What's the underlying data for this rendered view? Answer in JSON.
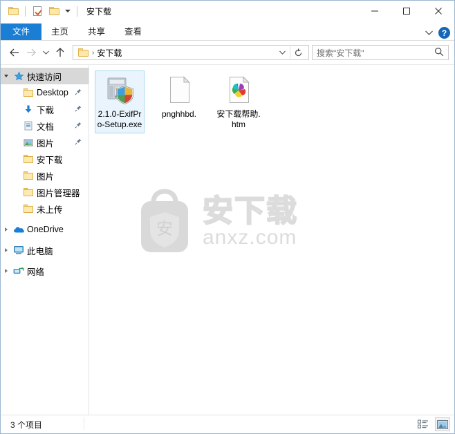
{
  "window": {
    "title": "安下载",
    "quick_access_toolbar": [
      {
        "name": "folder-icon",
        "label": "属性"
      },
      {
        "name": "properties-icon",
        "label": "属性"
      },
      {
        "name": "new-folder-icon",
        "label": "新建文件夹"
      },
      {
        "name": "chevron-down-icon",
        "label": "自定义快速访问工具栏"
      }
    ],
    "controls": {
      "minimize": "最小化",
      "maximize": "最大化",
      "close": "关闭"
    }
  },
  "ribbon": {
    "tabs": [
      {
        "label": "文件",
        "active": true
      },
      {
        "label": "主页",
        "active": false
      },
      {
        "label": "共享",
        "active": false
      },
      {
        "label": "查看",
        "active": false
      }
    ],
    "collapse_label": "展开功能区",
    "help_label": "?"
  },
  "address": {
    "back_label": "后退",
    "forward_label": "前进",
    "recent_label": "最近浏览的位置",
    "up_label": "上移到",
    "path_separator": "›",
    "path_text": "安下载",
    "dropdown_label": "以前的位置",
    "refresh_label": "刷新",
    "search_placeholder": "搜索\"安下载\""
  },
  "sidebar": {
    "items": [
      {
        "label": "快速访问",
        "icon": "star-pin-icon",
        "expander": "down",
        "indent": 0,
        "pinned": false,
        "hover": true
      },
      {
        "label": "Desktop",
        "icon": "folder-icon",
        "expander": "none",
        "indent": 1,
        "pinned": true,
        "hover": false
      },
      {
        "label": "下载",
        "icon": "download-arrow-icon",
        "expander": "none",
        "indent": 1,
        "pinned": true,
        "hover": false
      },
      {
        "label": "文档",
        "icon": "document-icon",
        "expander": "none",
        "indent": 1,
        "pinned": true,
        "hover": false
      },
      {
        "label": "图片",
        "icon": "pictures-icon",
        "expander": "none",
        "indent": 1,
        "pinned": true,
        "hover": false
      },
      {
        "label": "安下载",
        "icon": "folder-icon",
        "expander": "none",
        "indent": 1,
        "pinned": false,
        "hover": false
      },
      {
        "label": "图片",
        "icon": "folder-icon",
        "expander": "none",
        "indent": 1,
        "pinned": false,
        "hover": false
      },
      {
        "label": "图片管理器",
        "icon": "folder-icon",
        "expander": "none",
        "indent": 1,
        "pinned": false,
        "hover": false
      },
      {
        "label": "未上传",
        "icon": "folder-icon",
        "expander": "none",
        "indent": 1,
        "pinned": false,
        "hover": false
      },
      {
        "label": "OneDrive",
        "icon": "onedrive-cloud-icon",
        "expander": "right",
        "indent": 0,
        "pinned": false,
        "hover": false
      },
      {
        "label": "此电脑",
        "icon": "this-pc-icon",
        "expander": "right",
        "indent": 0,
        "pinned": false,
        "hover": false
      },
      {
        "label": "网络",
        "icon": "network-icon",
        "expander": "right",
        "indent": 0,
        "pinned": false,
        "hover": false
      }
    ]
  },
  "files": [
    {
      "name": "2.1.0-ExifPro-Setup.exe",
      "icon": "installer-exe-icon",
      "selected": true
    },
    {
      "name": "pnghhbd.",
      "icon": "blank-document-icon",
      "selected": false
    },
    {
      "name": "安下载帮助.htm",
      "icon": "html-document-icon",
      "selected": false
    }
  ],
  "watermark": {
    "badge_char": "安",
    "cn_text": "安下载",
    "en_text": "anxz.com",
    "color": "#dcdcdc"
  },
  "statusbar": {
    "item_count_text": "3 个项目",
    "views": [
      {
        "name": "details-view-icon",
        "label": "详细信息",
        "active": false
      },
      {
        "name": "large-icons-view-icon",
        "label": "大图标",
        "active": true
      }
    ]
  },
  "colors": {
    "accent": "#1a7fd4",
    "window_border": "#9ab6cf",
    "selection_fill": "#e9f4fd",
    "selection_border": "#a8d8f0",
    "folder_yellow": "#fdeab0"
  }
}
